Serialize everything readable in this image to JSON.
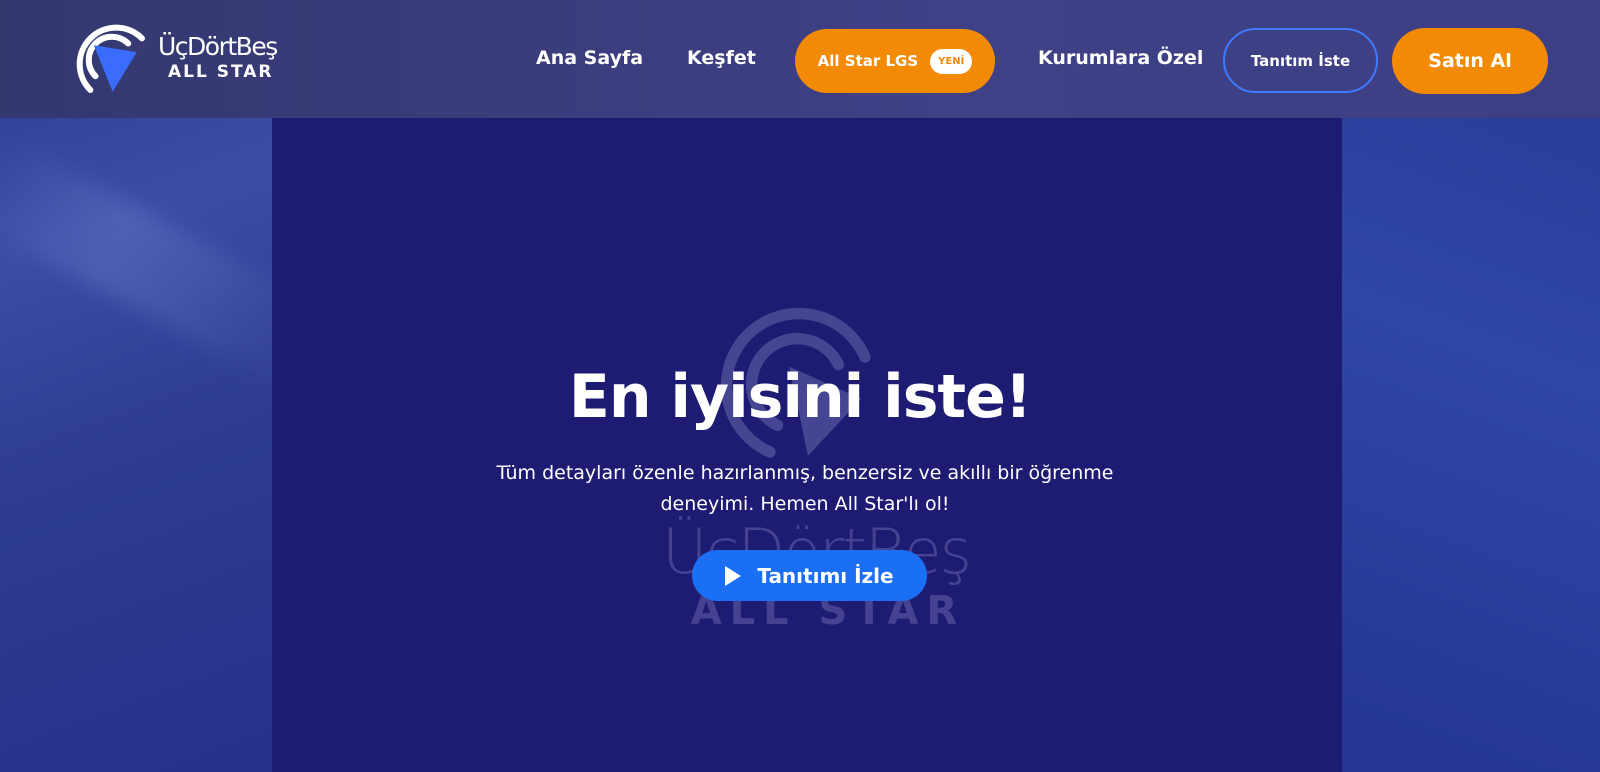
{
  "brand": {
    "name": "ÜçDörtBeş",
    "subtitle": "ALL STAR"
  },
  "nav": {
    "home": "Ana Sayfa",
    "explore": "Keşfet",
    "lgs_label": "All Star LGS",
    "new_badge": "YENİ",
    "corporate": "Kurumlara Özel",
    "demo_request": "Tanıtım İste",
    "buy": "Satın Al"
  },
  "hero": {
    "title": "En iyisini iste!",
    "subtitle": "Tüm detayları özenle hazırlanmış, benzersiz ve akıllı bir öğrenme deneyimi. Hemen All Star'lı ol!",
    "watch_button": "Tanıtımı İzle"
  },
  "watermark": {
    "name": "ÜçDörtBeş",
    "subtitle": "ALL STAR"
  },
  "icons": {
    "logo": "play-broadcast-logo-icon",
    "play": "play-icon"
  },
  "colors": {
    "header_bg": "#3d3f84",
    "accent_orange": "#f28a06",
    "accent_blue": "#1b6ff5",
    "video_panel": "#1e1b72",
    "page_bg": "#24318a"
  }
}
